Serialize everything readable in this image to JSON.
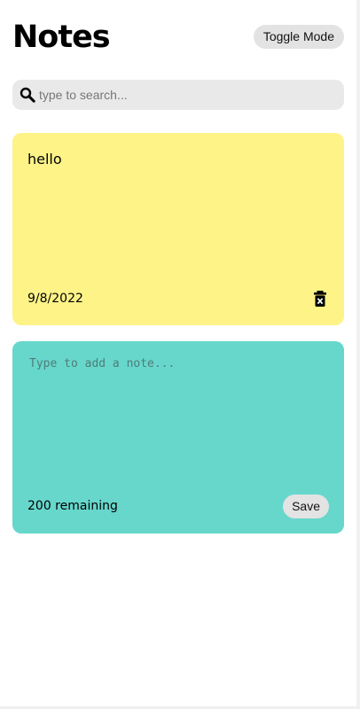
{
  "header": {
    "title": "Notes",
    "toggle_label": "Toggle Mode"
  },
  "search": {
    "icon": "search-icon",
    "placeholder": "type to search..."
  },
  "notes": [
    {
      "text": "hello",
      "date": "9/8/2022",
      "delete_icon": "trash-icon",
      "color": "#fef387"
    }
  ],
  "new_note": {
    "placeholder": "Type to add a note...",
    "remaining_label": "200 remaining",
    "save_label": "Save",
    "color": "#67d7cc"
  },
  "theme": {
    "background": "#ffffff",
    "button_bg": "#e3e3e3",
    "search_bg": "#e9e9e9"
  }
}
